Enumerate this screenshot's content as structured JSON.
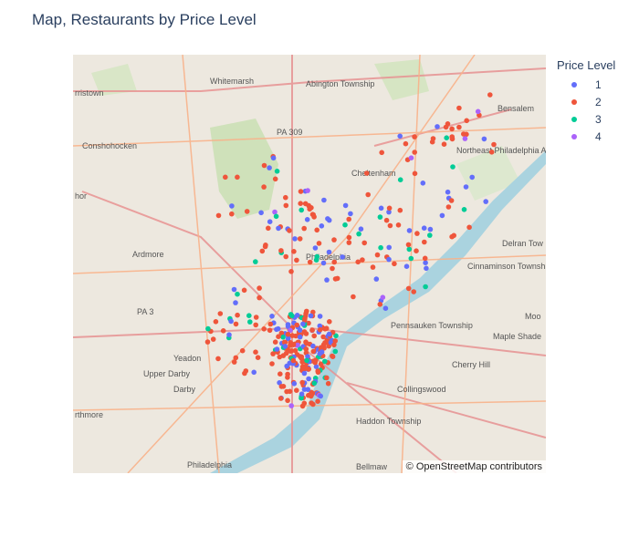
{
  "title": "Map, Restaurants by Price Level",
  "legend": {
    "title": "Price Level",
    "items": [
      {
        "label": "1",
        "color": "#636efa"
      },
      {
        "label": "2",
        "color": "#ef553b"
      },
      {
        "label": "3",
        "color": "#00cc96"
      },
      {
        "label": "4",
        "color": "#ab63fa"
      }
    ]
  },
  "attribution": "© OpenStreetMap contributors",
  "map_labels": [
    "Whitemarsh",
    "Abington Township",
    "Bensalem",
    "rristown",
    "Conshohocken",
    "Northeast Philadelphia Airport",
    "Cheltenham",
    "PA 309",
    "Ardmore",
    "Delran Tow",
    "Cinnaminson Township",
    "Philadelphia",
    "PA 3",
    "Pennsauken Township",
    "Maple Shade",
    "Yeadon",
    "Upper Darby",
    "Cherry Hill",
    "Darby",
    "Collingswood",
    "Haddon Township",
    "rthmore",
    "Philadelphia",
    "Bellmaw",
    "Moo",
    "hor"
  ]
}
